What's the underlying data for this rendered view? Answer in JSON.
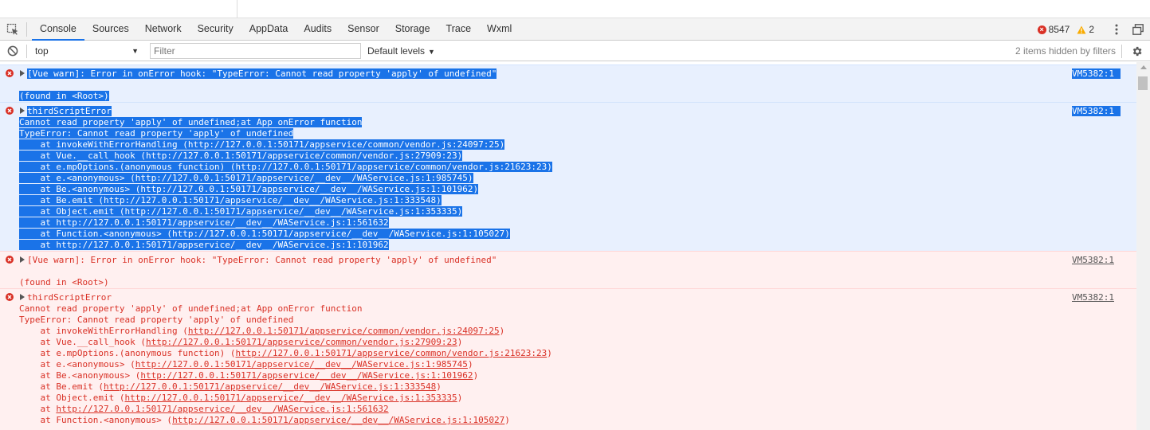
{
  "tabs": [
    {
      "label": "Console",
      "active": true
    },
    {
      "label": "Sources"
    },
    {
      "label": "Network"
    },
    {
      "label": "Security"
    },
    {
      "label": "AppData"
    },
    {
      "label": "Audits"
    },
    {
      "label": "Sensor"
    },
    {
      "label": "Storage"
    },
    {
      "label": "Trace"
    },
    {
      "label": "Wxml"
    }
  ],
  "counts": {
    "errors": "8547",
    "warnings": "2"
  },
  "filter": {
    "context": "top",
    "placeholder": "Filter",
    "levels": "Default levels",
    "hidden_note": "2 items hidden by filters"
  },
  "console": {
    "ghost": "                  ",
    "messages": [
      {
        "selected": true,
        "source": "VM5382:1",
        "lines": [
          "[Vue warn]: Error in onError hook: \"TypeError: Cannot read property 'apply' of undefined\"",
          "",
          "(found in <Root>)"
        ]
      },
      {
        "selected": true,
        "source": "VM5382:1",
        "lines": [
          "thirdScriptError",
          "Cannot read property 'apply' of undefined;at App onError function",
          "TypeError: Cannot read property 'apply' of undefined",
          "    at invokeWithErrorHandling (http://127.0.0.1:50171/appservice/common/vendor.js:24097:25)",
          "    at Vue.__call_hook (http://127.0.0.1:50171/appservice/common/vendor.js:27909:23)",
          "    at e.mpOptions.(anonymous function) (http://127.0.0.1:50171/appservice/common/vendor.js:21623:23)",
          "    at e.<anonymous> (http://127.0.0.1:50171/appservice/__dev__/WAService.js:1:985745)",
          "    at Be.<anonymous> (http://127.0.0.1:50171/appservice/__dev__/WAService.js:1:101962)",
          "    at Be.emit (http://127.0.0.1:50171/appservice/__dev__/WAService.js:1:333548)",
          "    at Object.emit (http://127.0.0.1:50171/appservice/__dev__/WAService.js:1:353335)",
          "    at http://127.0.0.1:50171/appservice/__dev__/WAService.js:1:561632",
          "    at Function.<anonymous> (http://127.0.0.1:50171/appservice/__dev__/WAService.js:1:105027)",
          "    at http://127.0.0.1:50171/appservice/__dev__/WAService.js:1:101962"
        ]
      },
      {
        "selected": false,
        "source": "VM5382:1",
        "lines": [
          "[Vue warn]: Error in onError hook: \"TypeError: Cannot read property 'apply' of undefined\"",
          "",
          "(found in <Root>)"
        ]
      },
      {
        "selected": false,
        "source": "VM5382:1",
        "lines": [
          "thirdScriptError",
          "Cannot read property 'apply' of undefined;at App onError function",
          "TypeError: Cannot read property 'apply' of undefined",
          "    at invokeWithErrorHandling (http://127.0.0.1:50171/appservice/common/vendor.js:24097:25)",
          "    at Vue.__call_hook (http://127.0.0.1:50171/appservice/common/vendor.js:27909:23)",
          "    at e.mpOptions.(anonymous function) (http://127.0.0.1:50171/appservice/common/vendor.js:21623:23)",
          "    at e.<anonymous> (http://127.0.0.1:50171/appservice/__dev__/WAService.js:1:985745)",
          "    at Be.<anonymous> (http://127.0.0.1:50171/appservice/__dev__/WAService.js:1:101962)",
          "    at Be.emit (http://127.0.0.1:50171/appservice/__dev__/WAService.js:1:333548)",
          "    at Object.emit (http://127.0.0.1:50171/appservice/__dev__/WAService.js:1:353335)",
          "    at http://127.0.0.1:50171/appservice/__dev__/WAService.js:1:561632",
          "    at Function.<anonymous> (http://127.0.0.1:50171/appservice/__dev__/WAService.js:1:105027)"
        ]
      }
    ]
  },
  "colors": {
    "error": "#d93025",
    "selection": "#1a73e8",
    "error_bg": "#fff0f0",
    "warning": "#f9ab00"
  }
}
